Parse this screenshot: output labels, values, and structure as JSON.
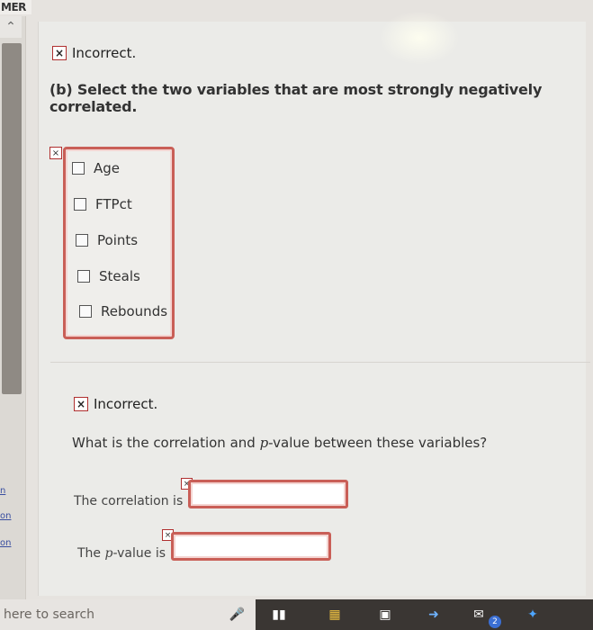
{
  "app": {
    "label": "MER"
  },
  "left_panel": {
    "links": [
      "n",
      "on",
      "on"
    ]
  },
  "part_b": {
    "feedback": "Incorrect.",
    "question": "(b) Select the two variables that are most strongly negatively correlated.",
    "choices": [
      "Age",
      "FTPct",
      "Points",
      "Steals",
      "Rebounds"
    ]
  },
  "part_c": {
    "feedback": "Incorrect.",
    "question_prefix": "What is the correlation and ",
    "question_var": "p",
    "question_suffix": "-value between these variables?",
    "correlation_label": "The correlation is",
    "pvalue_label_prefix": "The ",
    "pvalue_label_var": "p",
    "pvalue_label_suffix": "-value is",
    "correlation_value": "",
    "pvalue_value": ""
  },
  "taskbar": {
    "search_placeholder": "here to search",
    "icons": [
      "microphone-icon",
      "task-view-icon",
      "file-explorer-icon",
      "store-icon",
      "app-icon",
      "mail-icon",
      "dropbox-icon"
    ],
    "badge": "2"
  },
  "colors": {
    "error_border": "#c95f57",
    "panel_bg": "#ebebe8",
    "taskbar": "#3a3633"
  }
}
